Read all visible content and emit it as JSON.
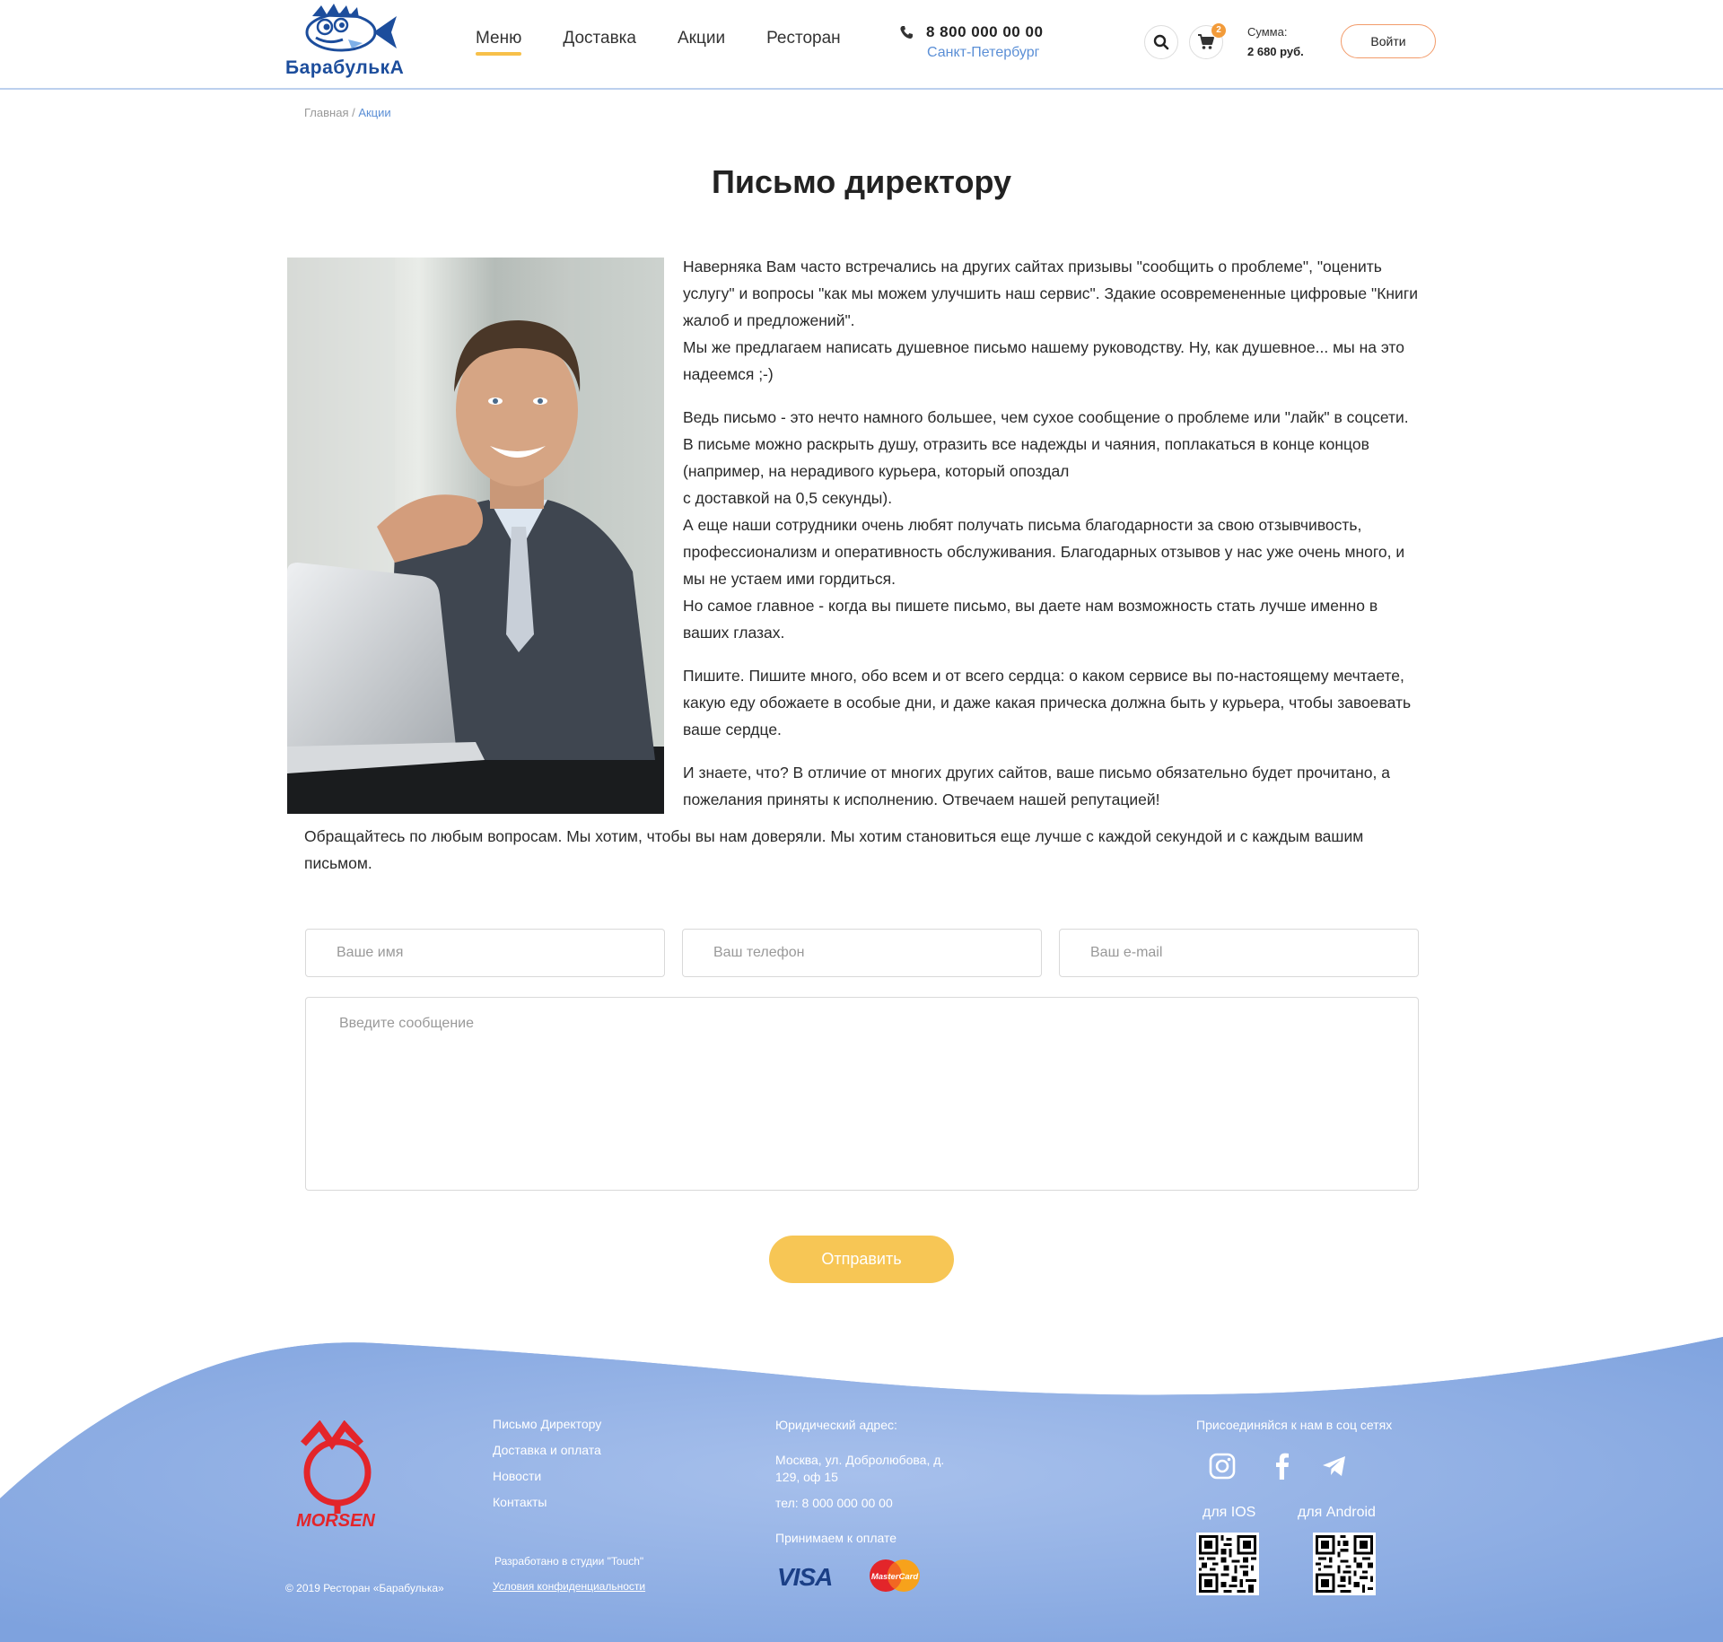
{
  "header": {
    "logo_text": "БарабулькА",
    "nav": [
      {
        "label": "Меню"
      },
      {
        "label": "Доставка"
      },
      {
        "label": "Акции"
      },
      {
        "label": "Ресторан"
      }
    ],
    "phone": "8 800 000 00 00",
    "city": "Санкт-Петербург",
    "cart_count": "2",
    "sum_label": "Сумма:",
    "sum_value": "2 680 руб.",
    "login": "Войти"
  },
  "breadcrumb": {
    "home": "Главная",
    "separator": " / ",
    "current": "Акции"
  },
  "page": {
    "title": "Письмо директору",
    "paragraphs": [
      "Наверняка Вам часто встречались на других сайтах призывы \"сообщить о проблеме\", \"оценить услугу\" и вопросы \"как мы можем улучшить наш сервис\". Здакие осовремененные цифровые \"Книги жалоб и предложений\".",
      "Мы же предлагаем написать душевное письмо нашему руководству. Ну, как душевное... мы на это надеемся ;-)",
      "Ведь письмо - это нечто намного большее, чем сухое сообщение о проблеме или \"лайк\" в соцсети. В письме можно раскрыть душу, отразить все надежды и чаяния, поплакаться в конце концов (например, на нерадивого курьера, который опоздал",
      "с доставкой на 0,5 секунды).",
      "А еще наши сотрудники очень любят получать письма благодарности за свою отзывчивость, профессионализм и оперативность обслуживания. Благодарных отзывов у нас уже очень много, и мы не устаем ими гордиться.",
      "Но самое главное - когда вы пишете письмо, вы даете нам возможность стать лучше именно в ваших глазах.",
      "Пишите. Пишите много, обо всем и от всего сердца: о каком сервисе вы по-настоящему мечтаете, какую еду обожаете в особые дни, и даже какая прическа должна быть у курьера, чтобы завоевать ваше сердце.",
      "И знаете, что? В отличие от многих других сайтов, ваше письмо обязательно будет прочитано, а пожелания приняты к исполнению. Отвечаем нашей репутацией!"
    ],
    "final_paragraph": "Обращайтесь по любым вопросам. Мы хотим, чтобы вы нам доверяли. Мы хотим становиться еще лучше с каждой секундой и с каждым вашим письмом."
  },
  "form": {
    "name_placeholder": "Ваше имя",
    "phone_placeholder": "Ваш телефон",
    "email_placeholder": "Ваш e-mail",
    "message_placeholder": "Введите сообщение",
    "submit": "Отправить"
  },
  "footer": {
    "brand": "MORSEN",
    "links": [
      {
        "label": "Письмо Директору"
      },
      {
        "label": "Доставка и оплата"
      },
      {
        "label": "Новости"
      },
      {
        "label": "Контакты"
      }
    ],
    "copyright": "© 2019 Ресторан «Барабулька»",
    "studio": "Разработано в студии \"Touch\"",
    "privacy": "Условия конфиденциальности",
    "legal_title": "Юридический адрес:",
    "legal_address": "Москва, ул. Добролюбова, д. 129, оф 15",
    "legal_phone": "тел: 8 000 000 00 00",
    "payment_title": "Принимаем к оплате",
    "visa": "VISA",
    "mastercard": "MasterCard",
    "social_title": "Присоединяйся к нам в соц сетях",
    "ios_label": "для IOS",
    "android_label": "для Android"
  },
  "colors": {
    "accent_yellow": "#f7c655",
    "link_blue": "#5b8fd6",
    "footer_blue": "#8eaee6",
    "brand_red": "#e3252a",
    "logo_blue": "#1c4d9c"
  },
  "icons": [
    "phone-icon",
    "search-icon",
    "cart-icon",
    "instagram-icon",
    "facebook-icon",
    "telegram-icon"
  ]
}
